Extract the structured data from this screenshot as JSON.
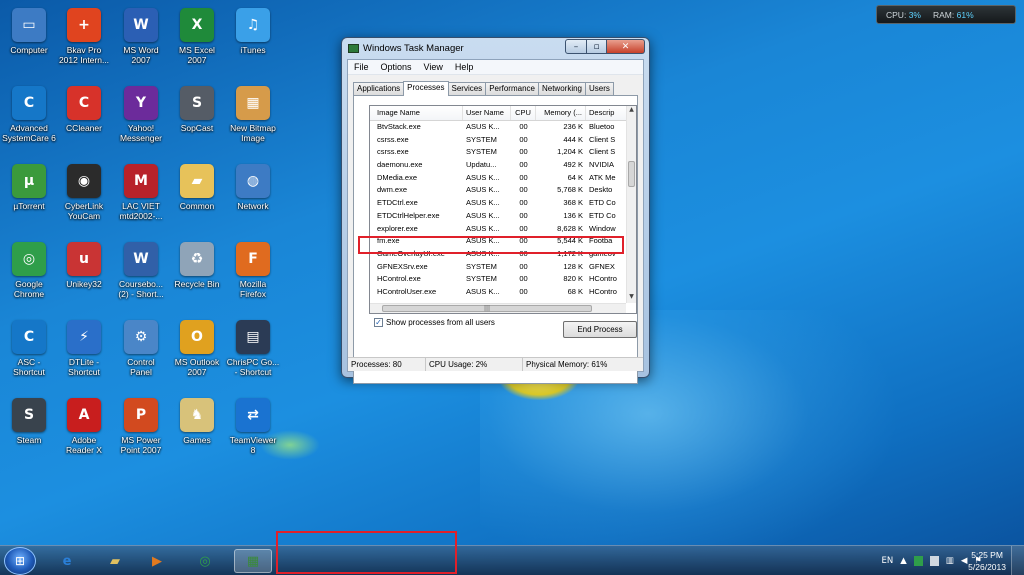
{
  "gadget": {
    "cpu_label": "CPU:",
    "cpu_value": "3%",
    "ram_label": "RAM:",
    "ram_value": "61%"
  },
  "desktop_icons": [
    {
      "label": "Computer",
      "icon": "computer-icon",
      "color": "#3d7bc4",
      "glyph": "▭"
    },
    {
      "label": "Bkav Pro\n2012 Intern...",
      "icon": "shield-icon",
      "color": "#e0441f",
      "glyph": "+"
    },
    {
      "label": "MS Word\n2007",
      "icon": "word-icon",
      "color": "#2b5fb4",
      "glyph": "W"
    },
    {
      "label": "MS Excel\n2007",
      "icon": "excel-icon",
      "color": "#1f8a3a",
      "glyph": "X"
    },
    {
      "label": "iTunes",
      "icon": "music-icon",
      "color": "#3aa0e8",
      "glyph": "♫"
    },
    {
      "label": "Advanced\nSystemCare 6",
      "icon": "systemcare-icon",
      "color": "#1577c8",
      "glyph": "C"
    },
    {
      "label": "CCleaner",
      "icon": "ccleaner-icon",
      "color": "#d7322a",
      "glyph": "C"
    },
    {
      "label": "Yahoo!\nMessenger",
      "icon": "yahoo-icon",
      "color": "#6c2b9b",
      "glyph": "Y"
    },
    {
      "label": "SopCast",
      "icon": "sopcast-icon",
      "color": "#555c66",
      "glyph": "S"
    },
    {
      "label": "New Bitmap\nImage",
      "icon": "bitmap-icon",
      "color": "#d69b4a",
      "glyph": "▦"
    },
    {
      "label": "µTorrent",
      "icon": "utorrent-icon",
      "color": "#3b9a3c",
      "glyph": "µ"
    },
    {
      "label": "CyberLink\nYouCam",
      "icon": "camera-icon",
      "color": "#2b2b2b",
      "glyph": "◉"
    },
    {
      "label": "LAC VIET\nmtd2002-...",
      "icon": "dictionary-icon",
      "color": "#b8222a",
      "glyph": "M"
    },
    {
      "label": "Common",
      "icon": "folder-icon",
      "color": "#e7c25a",
      "glyph": "▰"
    },
    {
      "label": "Network",
      "icon": "network-icon",
      "color": "#3d7bc4",
      "glyph": "◍"
    },
    {
      "label": "Google\nChrome",
      "icon": "chrome-icon",
      "color": "#2f9e4a",
      "glyph": "◎"
    },
    {
      "label": "Unikey32",
      "icon": "unikey-icon",
      "color": "#c93434",
      "glyph": "u"
    },
    {
      "label": "Coursebo...\n(2) - Short...",
      "icon": "document-icon",
      "color": "#3160a8",
      "glyph": "W"
    },
    {
      "label": "Recycle Bin",
      "icon": "recycle-bin-icon",
      "color": "#8fa4b8",
      "glyph": "♻"
    },
    {
      "label": "Mozilla\nFirefox",
      "icon": "firefox-icon",
      "color": "#e06b1f",
      "glyph": "F"
    },
    {
      "label": "ASC -\nShortcut",
      "icon": "systemcare-shortcut-icon",
      "color": "#1577c8",
      "glyph": "C"
    },
    {
      "label": "DTLite -\nShortcut",
      "icon": "daemon-tools-icon",
      "color": "#2a6fc9",
      "glyph": "⚡"
    },
    {
      "label": "Control\nPanel",
      "icon": "control-panel-icon",
      "color": "#4a86c8",
      "glyph": "⚙"
    },
    {
      "label": "MS Outlook\n2007",
      "icon": "outlook-icon",
      "color": "#e0a11f",
      "glyph": "O"
    },
    {
      "label": "ChrisPC Go...\n- Shortcut",
      "icon": "clapboard-icon",
      "color": "#2b3b55",
      "glyph": "▤"
    },
    {
      "label": "Steam",
      "icon": "steam-icon",
      "color": "#39434d",
      "glyph": "S"
    },
    {
      "label": "Adobe\nReader X",
      "icon": "pdf-icon",
      "color": "#c81e1e",
      "glyph": "A"
    },
    {
      "label": "MS Power\nPoint 2007",
      "icon": "powerpoint-icon",
      "color": "#d24a1f",
      "glyph": "P"
    },
    {
      "label": "Games",
      "icon": "games-folder-icon",
      "color": "#d8c27a",
      "glyph": "♞"
    },
    {
      "label": "TeamViewer\n8",
      "icon": "teamviewer-icon",
      "color": "#1a73d1",
      "glyph": "⇄"
    }
  ],
  "task_manager": {
    "title": "Windows Task Manager",
    "menu": [
      "File",
      "Options",
      "View",
      "Help"
    ],
    "tabs": [
      "Applications",
      "Processes",
      "Services",
      "Performance",
      "Networking",
      "Users"
    ],
    "active_tab": "Processes",
    "columns": [
      "Image Name",
      "User Name",
      "CPU",
      "Memory (...",
      "Descrip"
    ],
    "rows": [
      [
        "BtvStack.exe",
        "ASUS K...",
        "00",
        "236 K",
        "Bluetoo"
      ],
      [
        "csrss.exe",
        "SYSTEM",
        "00",
        "444 K",
        "Client S"
      ],
      [
        "csrss.exe",
        "SYSTEM",
        "00",
        "1,204 K",
        "Client S"
      ],
      [
        "daemonu.exe",
        "Updatu...",
        "00",
        "492 K",
        "NVIDIA"
      ],
      [
        "DMedia.exe",
        "ASUS K...",
        "00",
        "64 K",
        "ATK Me"
      ],
      [
        "dwm.exe",
        "ASUS K...",
        "00",
        "5,768 K",
        "Deskto"
      ],
      [
        "ETDCtrl.exe",
        "ASUS K...",
        "00",
        "368 K",
        "ETD Co"
      ],
      [
        "ETDCtrlHelper.exe",
        "ASUS K...",
        "00",
        "136 K",
        "ETD Co"
      ],
      [
        "explorer.exe",
        "ASUS K...",
        "00",
        "8,628 K",
        "Window"
      ],
      [
        "fm.exe",
        "ASUS K...",
        "00",
        "5,544 K",
        "Footba"
      ],
      [
        "GameOverlayUI.exe",
        "ASUS K...",
        "00",
        "1,172 K",
        "gameov"
      ],
      [
        "GFNEXSrv.exe",
        "SYSTEM",
        "00",
        "128 K",
        "GFNEX"
      ],
      [
        "HControl.exe",
        "SYSTEM",
        "00",
        "820 K",
        "HContro"
      ],
      [
        "HControlUser.exe",
        "ASUS K...",
        "00",
        "68 K",
        "HContro"
      ]
    ],
    "highlighted_row": "fm.exe",
    "show_all_label": "Show processes from all users",
    "end_process_label": "End Process",
    "status": {
      "processes": "Processes: 80",
      "cpu": "CPU Usage: 2%",
      "memory": "Physical Memory: 61%"
    }
  },
  "taskbar": {
    "pinned": [
      {
        "name": "internet-explorer-icon",
        "glyph": "e",
        "color": "#2a7fd8"
      },
      {
        "name": "explorer-folder-icon",
        "glyph": "▰",
        "color": "#e0c060"
      },
      {
        "name": "media-player-icon",
        "glyph": "▶",
        "color": "#e07a20"
      },
      {
        "name": "chrome-icon",
        "glyph": "◎",
        "color": "#2f9e4a"
      },
      {
        "name": "task-manager-icon",
        "glyph": "▦",
        "color": "#3a8a3a"
      }
    ],
    "language": "EN",
    "time": "5:25 PM",
    "date": "5/26/2013"
  }
}
